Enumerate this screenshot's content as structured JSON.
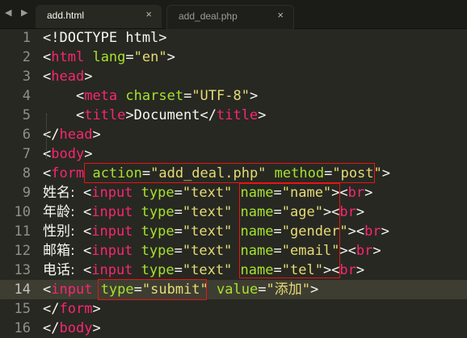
{
  "tabs": {
    "nav_arrows": "◀ ▶",
    "active": {
      "label": "add.html",
      "close": "×"
    },
    "inactive": {
      "label": "add_deal.php",
      "close": "×"
    }
  },
  "line_numbers": [
    "1",
    "2",
    "3",
    "4",
    "5",
    "6",
    "7",
    "8",
    "9",
    "10",
    "11",
    "12",
    "13",
    "14",
    "15",
    "16"
  ],
  "current_line": "14",
  "code": {
    "l1": {
      "a": "<!DOCTYPE html>"
    },
    "l2": {
      "a": "<",
      "b": "html",
      "c": " ",
      "d": "lang",
      "e": "=",
      "f": "\"en\"",
      "g": ">"
    },
    "l3": {
      "a": "<",
      "b": "head",
      "c": ">"
    },
    "l4": {
      "indent": "    ",
      "a": "<",
      "b": "meta",
      "c": " ",
      "d": "charset",
      "e": "=",
      "f": "\"UTF-8\"",
      "g": ">"
    },
    "l5": {
      "indent": "    ",
      "a": "<",
      "b": "title",
      "c": ">Document</",
      "d": "title",
      "e": ">"
    },
    "l6": {
      "a": "</",
      "b": "head",
      "c": ">"
    },
    "l7": {
      "a": "<",
      "b": "body",
      "c": ">"
    },
    "l8": {
      "a": "<",
      "b": "form",
      "c": " ",
      "d": "action",
      "e": "=",
      "f": "\"add_deal.php\"",
      "g": " ",
      "h": "method",
      "i": "=",
      "j": "\"post\"",
      "k": ">"
    },
    "l9": {
      "label": "姓名:",
      "sp": " ",
      "a": "<",
      "b": "input",
      "c": " ",
      "d": "type",
      "e": "=",
      "f": "\"text\"",
      "g": " ",
      "h": "name",
      "i": "=",
      "j": "\"name\"",
      "k": "><",
      "l": "br",
      "m": ">"
    },
    "l10": {
      "label": "年龄:",
      "sp": " ",
      "a": "<",
      "b": "input",
      "c": " ",
      "d": "type",
      "e": "=",
      "f": "\"text\"",
      "g": " ",
      "h": "name",
      "i": "=",
      "j": "\"age\"",
      "k": "><",
      "l": "br",
      "m": ">"
    },
    "l11": {
      "label": "性别:",
      "sp": " ",
      "a": "<",
      "b": "input",
      "c": " ",
      "d": "type",
      "e": "=",
      "f": "\"text\"",
      "g": " ",
      "h": "name",
      "i": "=",
      "j": "\"gender\"",
      "k": "><",
      "l": "br",
      "m": ">"
    },
    "l12": {
      "label": "邮箱:",
      "sp": " ",
      "a": "<",
      "b": "input",
      "c": " ",
      "d": "type",
      "e": "=",
      "f": "\"text\"",
      "g": " ",
      "h": "name",
      "i": "=",
      "j": "\"email\"",
      "k": "><",
      "l": "br",
      "m": ">"
    },
    "l13": {
      "label": "电话:",
      "sp": " ",
      "a": "<",
      "b": "input",
      "c": " ",
      "d": "type",
      "e": "=",
      "f": "\"text\"",
      "g": " ",
      "h": "name",
      "i": "=",
      "j": "\"tel\"",
      "k": "><",
      "l": "br",
      "m": ">"
    },
    "l14": {
      "a": "<",
      "b": "input",
      "c": " ",
      "d": "type",
      "e": "=",
      "f": "\"submit\"",
      "g": " ",
      "h": "value",
      "i": "=",
      "j": "\"添加\"",
      "k": ">"
    },
    "l15": {
      "a": "</",
      "b": "form",
      "c": ">"
    },
    "l16": {
      "a": "</",
      "b": "body",
      "c": ">"
    }
  },
  "colors": {
    "background": "#272822",
    "tag": "#f92672",
    "attribute": "#a6e22e",
    "string": "#e6db74",
    "text": "#f8f8f2",
    "annotation_box": "#e81414"
  }
}
